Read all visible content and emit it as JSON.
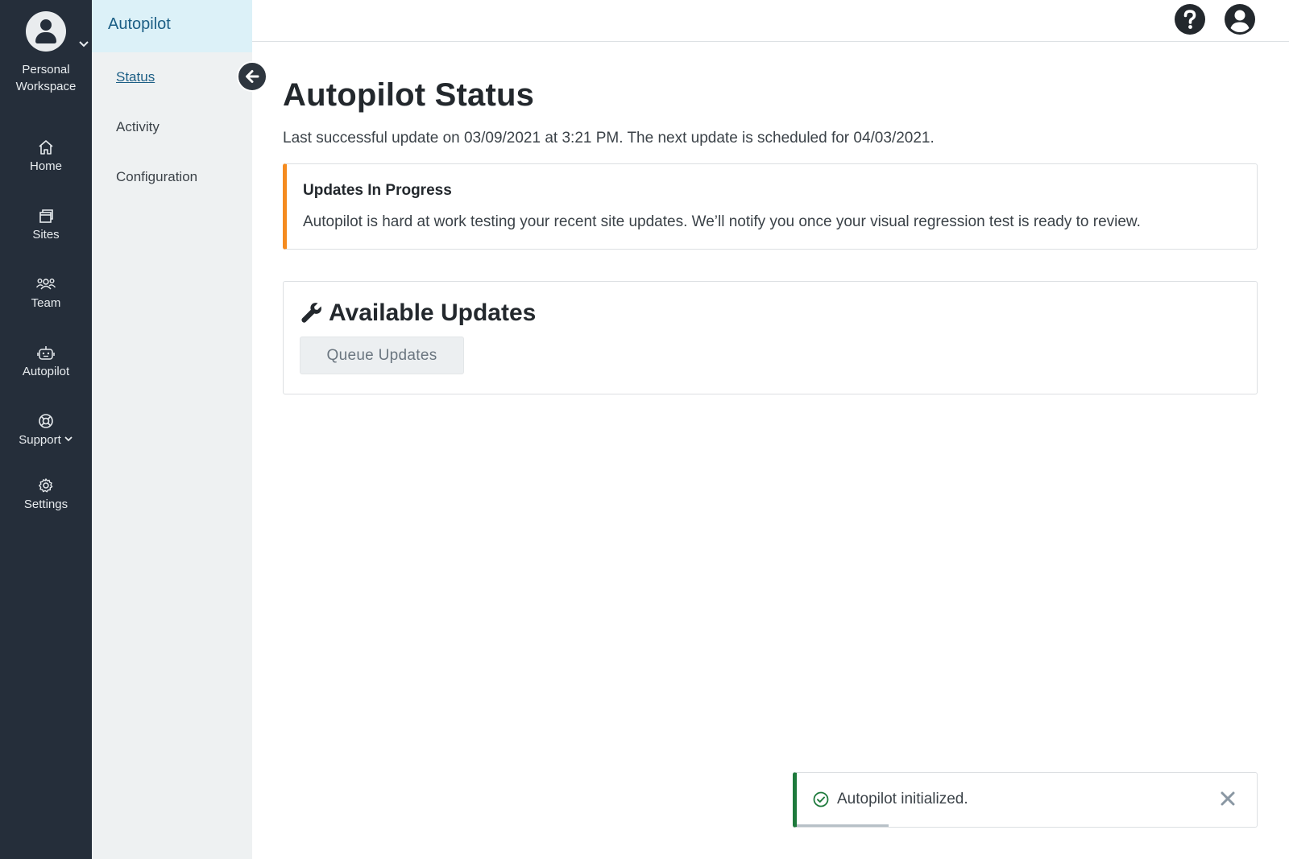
{
  "workspace": {
    "label_line1": "Personal",
    "label_line2": "Workspace"
  },
  "rail": {
    "home": "Home",
    "sites": "Sites",
    "team": "Team",
    "autopilot": "Autopilot",
    "support": "Support",
    "settings": "Settings"
  },
  "subnav": {
    "title": "Autopilot",
    "items": [
      {
        "label": "Status",
        "active": true
      },
      {
        "label": "Activity",
        "active": false
      },
      {
        "label": "Configuration",
        "active": false
      }
    ]
  },
  "topbar": {
    "help_icon": "question-circle-icon",
    "account_icon": "user-circle-icon"
  },
  "main": {
    "title": "Autopilot Status",
    "subtitle": "Last successful update on 03/09/2021 at 3:21 PM. The next update is scheduled for 04/03/2021.",
    "alert": {
      "title": "Updates In Progress",
      "body": "Autopilot is hard at work testing your recent site updates. We’ll notify you once your visual regression test is ready to review."
    },
    "updates_panel": {
      "title": "Available Updates",
      "button": "Queue Updates"
    }
  },
  "toast": {
    "message": "Autopilot initialized.",
    "progress": 0.2
  },
  "colors": {
    "rail_bg": "#252e3a",
    "subnav_bg": "#eef1f2",
    "subnav_active_bg": "#dcf1f8",
    "link": "#1b5e85",
    "alert_accent": "#f58b1f",
    "toast_accent": "#1e7a3c"
  }
}
